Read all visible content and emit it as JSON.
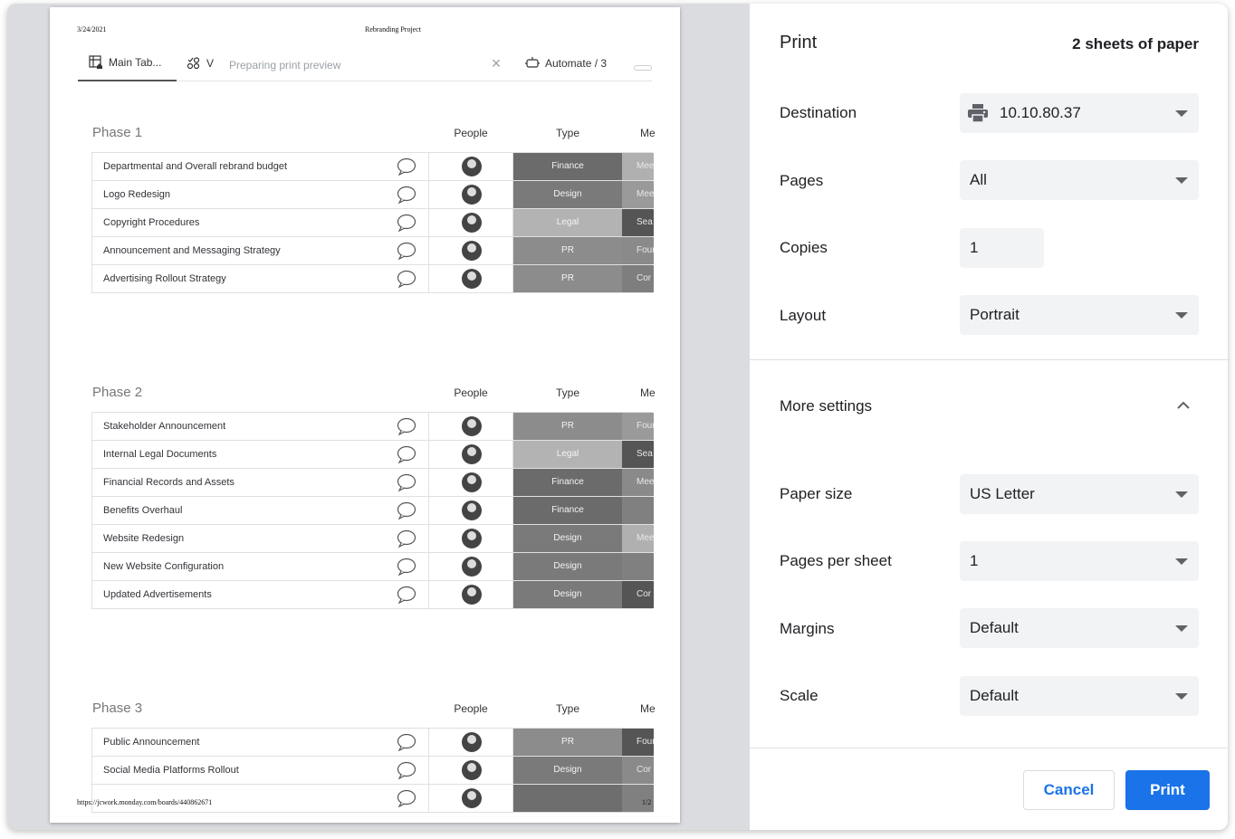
{
  "sheet": {
    "header_date": "3/24/2021",
    "header_title": "Rebranding Project",
    "footer_url": "https://jcwork.monday.com/boards/440862671",
    "footer_page": "1/2",
    "tabs": {
      "main": "Main Tab...",
      "v": "V",
      "preparing": "Preparing print preview",
      "automate": "Automate / 3"
    },
    "columns": {
      "people": "People",
      "type": "Type",
      "me": "Me"
    },
    "groups": [
      {
        "title": "Phase 1",
        "rows": [
          {
            "name": "Departmental and Overall rebrand budget",
            "type": "Finance",
            "me": "Mee"
          },
          {
            "name": "Logo Redesign",
            "type": "Design",
            "me": "Mee"
          },
          {
            "name": "Copyright Procedures",
            "type": "Legal",
            "me": "Sea"
          },
          {
            "name": "Announcement and Messaging Strategy",
            "type": "PR",
            "me": "Foun"
          },
          {
            "name": "Advertising Rollout Strategy",
            "type": "PR",
            "me": "Cor"
          }
        ]
      },
      {
        "title": "Phase 2",
        "rows": [
          {
            "name": "Stakeholder Announcement",
            "type": "PR",
            "me": "Foun"
          },
          {
            "name": "Internal Legal Documents",
            "type": "Legal",
            "me": "Sea"
          },
          {
            "name": "Financial Records and Assets",
            "type": "Finance",
            "me": "Mee"
          },
          {
            "name": "Benefits Overhaul",
            "type": "Finance",
            "me": ""
          },
          {
            "name": "Website Redesign",
            "type": "Design",
            "me": "Mee"
          },
          {
            "name": "New Website Configuration",
            "type": "Design",
            "me": ""
          },
          {
            "name": "Updated Advertisements",
            "type": "Design",
            "me": "Cor"
          }
        ]
      },
      {
        "title": "Phase 3",
        "rows": [
          {
            "name": "Public Announcement",
            "type": "PR",
            "me": "Foun"
          },
          {
            "name": "Social Media Platforms Rollout",
            "type": "Design",
            "me": "Cor"
          },
          {
            "name": "",
            "type": "",
            "me": ""
          }
        ]
      }
    ]
  },
  "panel": {
    "title": "Print",
    "sheets": "2 sheets of paper",
    "destination_label": "Destination",
    "destination_value": "10.10.80.37",
    "pages_label": "Pages",
    "pages_value": "All",
    "copies_label": "Copies",
    "copies_value": "1",
    "layout_label": "Layout",
    "layout_value": "Portrait",
    "more_settings": "More settings",
    "paper_size_label": "Paper size",
    "paper_size_value": "US Letter",
    "pages_per_sheet_label": "Pages per sheet",
    "pages_per_sheet_value": "1",
    "margins_label": "Margins",
    "margins_value": "Default",
    "scale_label": "Scale",
    "scale_value": "Default",
    "cancel": "Cancel",
    "print": "Print"
  },
  "colors": {
    "accent": "#1a73e8",
    "type_finance": "#6b6b6b",
    "type_design": "#7a7a7a",
    "type_legal": "#b3b3b3",
    "type_pr": "#8c8c8c"
  }
}
